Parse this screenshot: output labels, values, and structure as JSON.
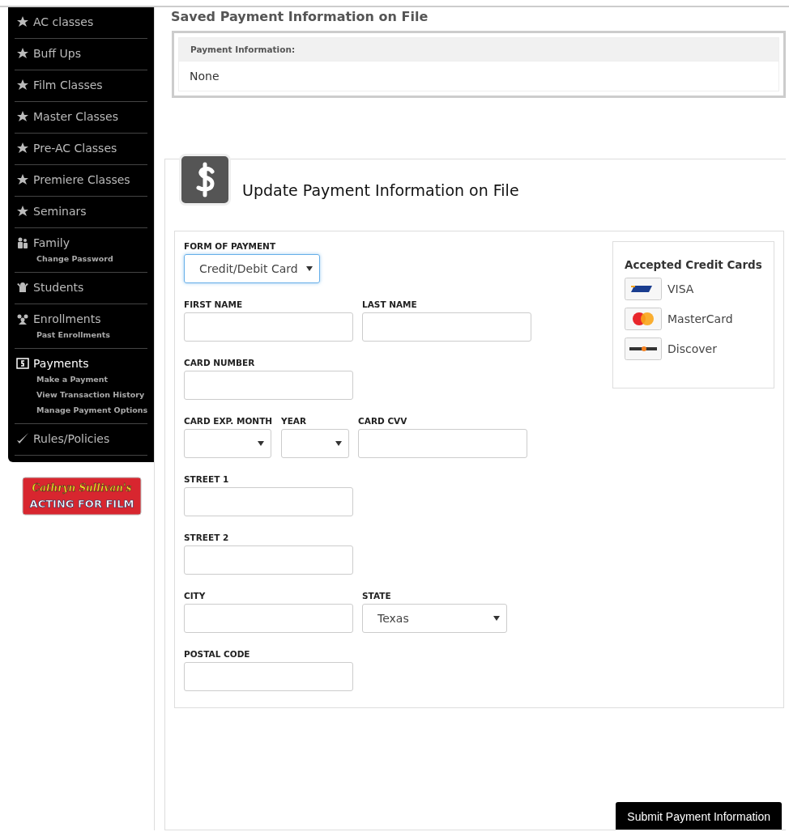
{
  "sidebar": {
    "items": [
      {
        "kind": "star",
        "label": "AC classes",
        "selected": false
      },
      {
        "kind": "star",
        "label": "Buff Ups",
        "selected": false
      },
      {
        "kind": "star",
        "label": "Film Classes",
        "selected": false
      },
      {
        "kind": "star",
        "label": "Master Classes",
        "selected": false
      },
      {
        "kind": "star",
        "label": "Pre-AC Classes",
        "selected": false
      },
      {
        "kind": "star",
        "label": "Premiere Classes",
        "selected": false
      },
      {
        "kind": "star",
        "label": "Seminars",
        "selected": false
      },
      {
        "kind": "family",
        "label": "Family",
        "selected": false,
        "children": [
          "Change Password"
        ]
      },
      {
        "kind": "student",
        "label": "Students",
        "selected": false
      },
      {
        "kind": "group",
        "label": "Enrollments",
        "selected": false,
        "children": [
          "Past Enrollments"
        ]
      },
      {
        "kind": "dollar",
        "label": "Payments",
        "selected": true,
        "children": [
          "Make a Payment",
          "View Transaction History",
          "Manage Payment Options"
        ]
      },
      {
        "kind": "check",
        "label": "Rules/Policies",
        "selected": false
      }
    ],
    "logo": {
      "line_1": "Cathryn Sullivan's",
      "line_2": "ACTING FOR FILM"
    }
  },
  "saved": {
    "title": "Saved Payment Information on File",
    "header": "Payment Information:",
    "value": "None"
  },
  "update": {
    "title": "Update Payment Information on File",
    "form": {
      "rows": [
        [
          {
            "label": "FORM OF PAYMENT",
            "kind": "select",
            "value": "Credit/Debit Card",
            "focused": true
          }
        ],
        [
          {
            "label": "FIRST NAME",
            "kind": "text",
            "focused": false
          },
          {
            "label": "LAST NAME",
            "kind": "text",
            "focused": false
          }
        ],
        [
          {
            "label": "CARD NUMBER",
            "kind": "text",
            "focused": false
          }
        ],
        [
          {
            "label": "CARD EXP. MONTH",
            "kind": "select",
            "focused": false
          },
          {
            "label": "YEAR",
            "kind": "select",
            "focused": false
          },
          {
            "label": "CARD CVV",
            "kind": "text",
            "focused": false
          }
        ],
        [
          {
            "label": "STREET 1",
            "kind": "text",
            "focused": false
          }
        ],
        [
          {
            "label": "STREET 2",
            "kind": "text",
            "focused": false
          }
        ],
        [
          {
            "label": "CITY",
            "kind": "text",
            "focused": false
          },
          {
            "label": "STATE",
            "kind": "select",
            "value": "Texas",
            "focused": false
          }
        ],
        [
          {
            "label": "POSTAL CODE",
            "kind": "text",
            "focused": false
          }
        ]
      ]
    },
    "cards": {
      "title": "Accepted Credit Cards",
      "items": [
        {
          "kind": "visa",
          "label": "VISA"
        },
        {
          "kind": "mastercard",
          "label": "MasterCard"
        },
        {
          "kind": "discover",
          "label": "Discover"
        }
      ]
    },
    "submit": "Submit Payment Information"
  }
}
